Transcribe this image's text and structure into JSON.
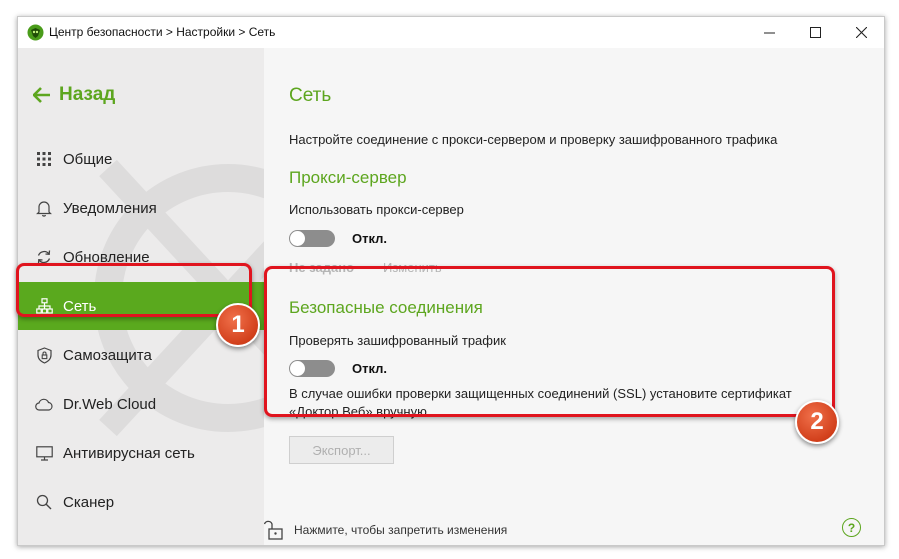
{
  "window": {
    "title": "Центр безопасности > Настройки > Сеть"
  },
  "sidebar": {
    "back_label": "Назад",
    "items": [
      {
        "label": "Общие",
        "icon": "grid-icon"
      },
      {
        "label": "Уведомления",
        "icon": "bell-icon"
      },
      {
        "label": "Обновление",
        "icon": "refresh-icon"
      },
      {
        "label": "Сеть",
        "icon": "network-icon",
        "active": true
      },
      {
        "label": "Самозащита",
        "icon": "shield-icon"
      },
      {
        "label": "Dr.Web Cloud",
        "icon": "cloud-icon"
      },
      {
        "label": "Антивирусная сеть",
        "icon": "monitor-icon"
      },
      {
        "label": "Сканер",
        "icon": "search-icon"
      }
    ],
    "active_color": "#5aa91e"
  },
  "main": {
    "title": "Сеть",
    "description": "Настройте соединение с прокси-сервером и проверку зашифрованного трафика",
    "proxy": {
      "heading": "Прокси-сервер",
      "label": "Использовать прокси-сервер",
      "toggle_state": "Откл.",
      "not_set": "Не задано",
      "change": "Изменить"
    },
    "secure": {
      "heading": "Безопасные соединения",
      "label": "Проверять зашифрованный трафик",
      "toggle_state": "Откл.",
      "note": "В случае ошибки проверки защищенных соединений (SSL) установите сертификат «Доктор Веб» вручную.",
      "export_label": "Экспорт..."
    },
    "footer": {
      "lock_text": "Нажмите, чтобы запретить изменения",
      "help": "?"
    }
  },
  "annotations": {
    "badge_1": "1",
    "badge_2": "2",
    "highlight_color": "#e0141e"
  },
  "colors": {
    "accent": "#5da61f"
  }
}
